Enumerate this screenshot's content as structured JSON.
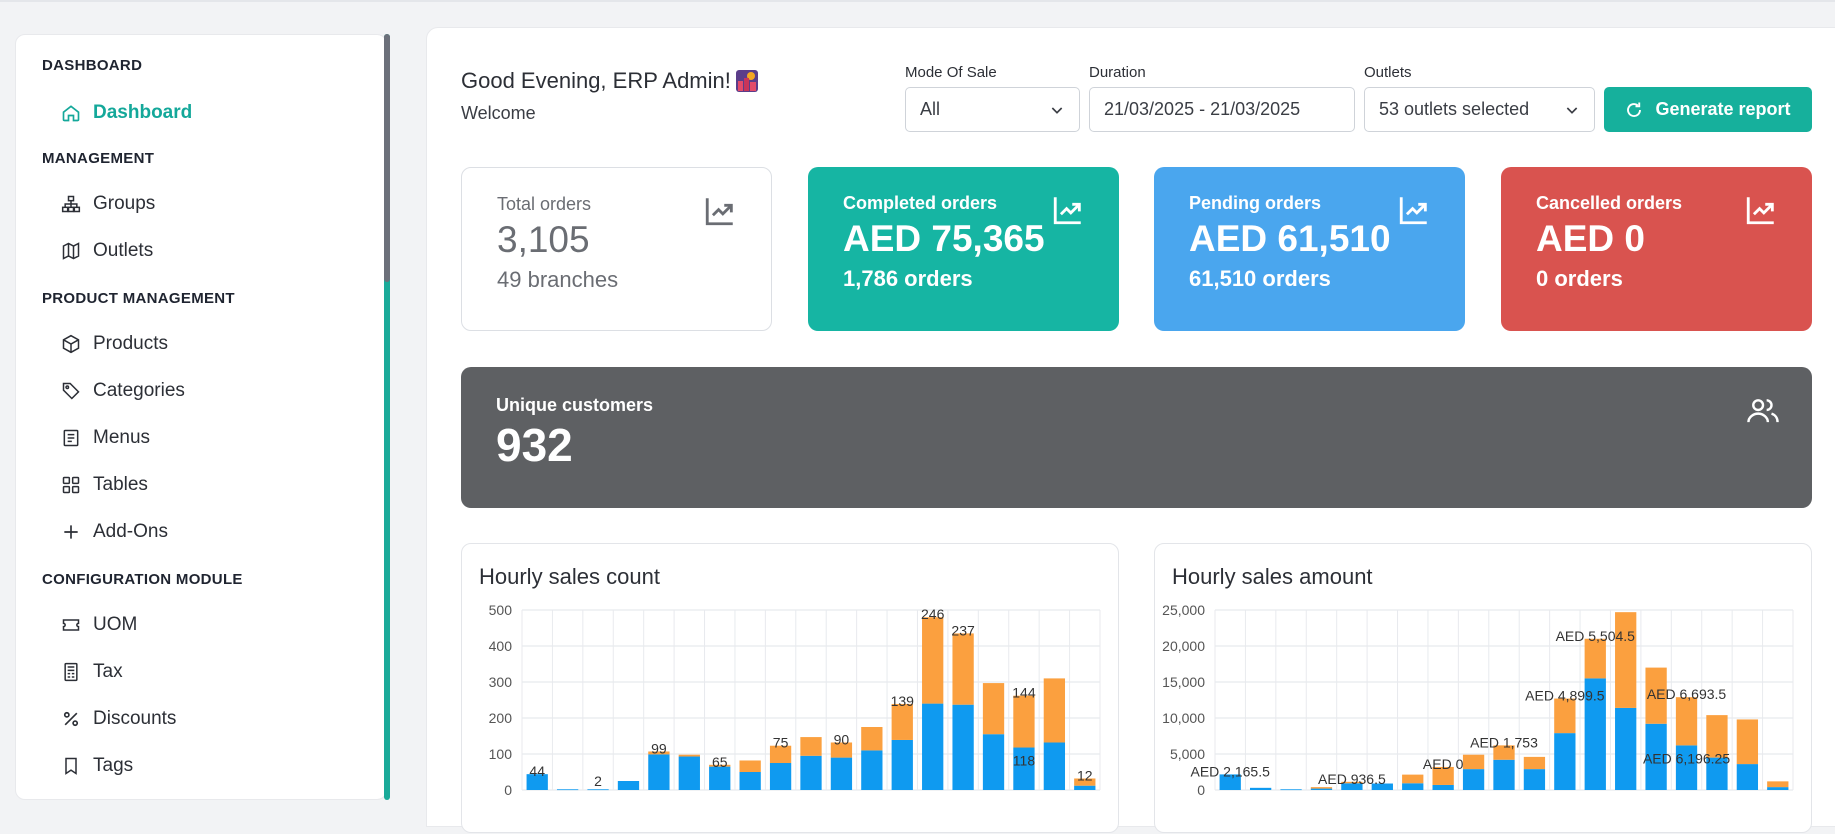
{
  "sidebar": {
    "sections": [
      {
        "title": "DASHBOARD",
        "items": [
          {
            "label": "Dashboard",
            "icon": "home-icon",
            "active": true
          }
        ]
      },
      {
        "title": "MANAGEMENT",
        "items": [
          {
            "label": "Groups",
            "icon": "sitemap-icon"
          },
          {
            "label": "Outlets",
            "icon": "map-icon"
          }
        ]
      },
      {
        "title": "PRODUCT MANAGEMENT",
        "items": [
          {
            "label": "Products",
            "icon": "box-icon"
          },
          {
            "label": "Categories",
            "icon": "tag-icon"
          },
          {
            "label": "Menus",
            "icon": "menu-book-icon"
          },
          {
            "label": "Tables",
            "icon": "grid-icon"
          },
          {
            "label": "Add-Ons",
            "icon": "plus-icon"
          }
        ]
      },
      {
        "title": "CONFIGURATION MODULE",
        "items": [
          {
            "label": "UOM",
            "icon": "ticket-icon"
          },
          {
            "label": "Tax",
            "icon": "receipt-icon"
          },
          {
            "label": "Discounts",
            "icon": "percent-icon"
          },
          {
            "label": "Tags",
            "icon": "bookmark-icon"
          }
        ]
      }
    ]
  },
  "header": {
    "greeting": "Good Evening, ERP Admin!",
    "greeting_icon": "night-city-emoji-icon",
    "welcome": "Welcome"
  },
  "filters": {
    "mode_label": "Mode Of Sale",
    "mode_value": "All",
    "duration_label": "Duration",
    "duration_value": "21/03/2025 - 21/03/2025",
    "outlets_label": "Outlets",
    "outlets_value": "53 outlets selected",
    "generate_label": "Generate report"
  },
  "cards": {
    "total": {
      "title": "Total orders",
      "value": "3,105",
      "sub": "49 branches"
    },
    "completed": {
      "title": "Completed orders",
      "value": "AED 75,365",
      "sub": "1,786 orders"
    },
    "pending": {
      "title": "Pending orders",
      "value": "AED 61,510",
      "sub": "61,510 orders"
    },
    "cancelled": {
      "title": "Cancelled orders",
      "value": "AED 0",
      "sub": "0 orders"
    }
  },
  "unique": {
    "title": "Unique customers",
    "value": "932"
  },
  "colors": {
    "accent": "#16b09c",
    "completed": "#16b5a3",
    "pending": "#4aa6ee",
    "cancelled": "#d9534f",
    "bar_blue": "#0f9af0",
    "bar_orange": "#fba03f"
  },
  "chart_data": [
    {
      "type": "bar",
      "title": "Hourly sales count",
      "stacked": true,
      "ylim": [
        0,
        500
      ],
      "yticks": [
        "500",
        "400",
        "300",
        "200",
        "100",
        "0"
      ],
      "grid": true,
      "series": [
        {
          "color": "#0f9af0",
          "values": [
            44,
            2,
            2,
            25,
            99,
            93,
            65,
            50,
            75,
            95,
            90,
            110,
            139,
            240,
            237,
            155,
            118,
            132,
            12
          ]
        },
        {
          "color": "#fba03f",
          "values": [
            0,
            0,
            0,
            0,
            8,
            5,
            5,
            32,
            48,
            52,
            42,
            65,
            100,
            240,
            198,
            142,
            144,
            178,
            20
          ]
        }
      ],
      "data_labels": [
        {
          "i": 0,
          "text": "44"
        },
        {
          "i": 2,
          "text": "2"
        },
        {
          "i": 4,
          "text": "99"
        },
        {
          "i": 6,
          "text": "65"
        },
        {
          "i": 8,
          "text": "75"
        },
        {
          "i": 10,
          "text": "90"
        },
        {
          "i": 12,
          "text": "139"
        },
        {
          "i": 13,
          "text": "246"
        },
        {
          "i": 14,
          "text": "237"
        },
        {
          "i": 16,
          "text": "144"
        },
        {
          "i": 16,
          "text": "118",
          "inner": true
        },
        {
          "i": 18,
          "text": "12"
        }
      ]
    },
    {
      "type": "bar",
      "title": "Hourly sales amount",
      "stacked": true,
      "ylim": [
        0,
        25000
      ],
      "yticks": [
        "25,000",
        "20,000",
        "15,000",
        "10,000",
        "5,000",
        "0"
      ],
      "grid": true,
      "series": [
        {
          "color": "#0f9af0",
          "values": [
            2165.5,
            300,
            100,
            200,
            936.5,
            900,
            936.5,
            700,
            2900,
            4200,
            2900,
            7900,
            15500,
            11400,
            9200,
            6196.25,
            4500,
            3600,
            400
          ]
        },
        {
          "color": "#fba03f",
          "values": [
            0,
            0,
            0,
            200,
            200,
            0,
            1200,
            2500,
            2000,
            2000,
            1700,
            4800,
            5504.5,
            13300,
            7800,
            6693.5,
            5900,
            6200,
            800
          ]
        }
      ],
      "data_labels": [
        {
          "i": 0,
          "text": "AED 2,165.5"
        },
        {
          "i": 4,
          "text": "AED 936.5"
        },
        {
          "i": 7,
          "text": "AED 0"
        },
        {
          "i": 9,
          "text": "AED 1,753"
        },
        {
          "i": 11,
          "text": "AED 4,899.5"
        },
        {
          "i": 12,
          "text": "AED 5,504.5"
        },
        {
          "i": 15,
          "text": "AED 6,693.5"
        },
        {
          "i": 15,
          "text": "AED 6,196.25",
          "inner": true
        }
      ]
    }
  ]
}
